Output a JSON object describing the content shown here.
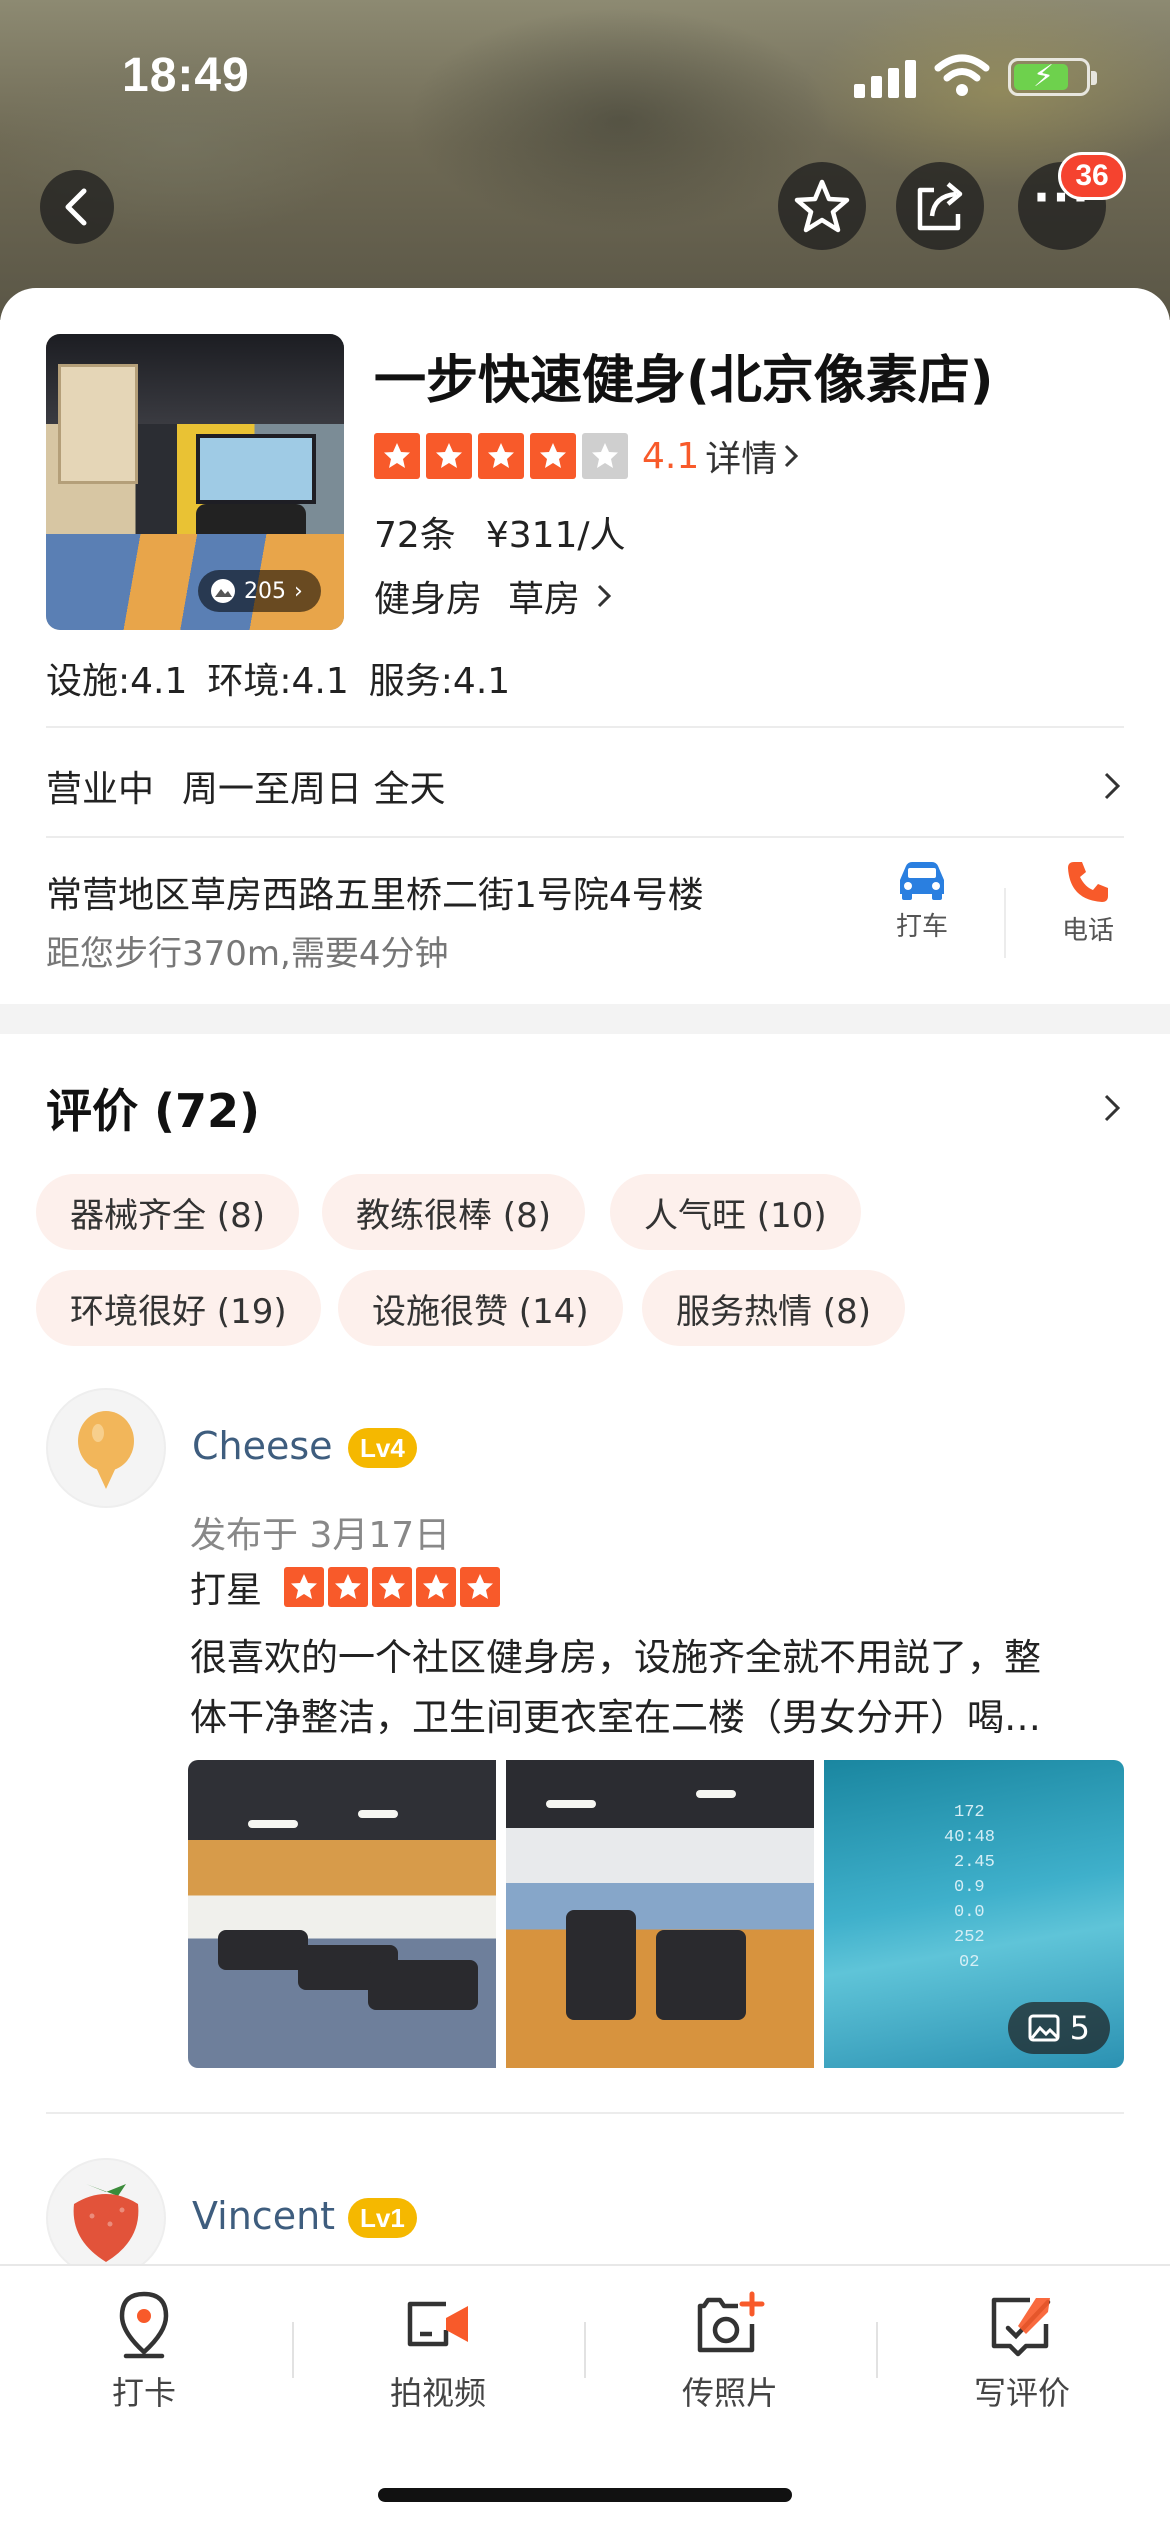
{
  "status_bar": {
    "time": "18:49"
  },
  "header": {
    "notification_count": "36"
  },
  "shop": {
    "name": "一步快速健身(北京像素店)",
    "photo_count": "205",
    "rating": "4.1",
    "rating_stars": 4,
    "detail_link": "详情",
    "review_count": "72条",
    "price": "¥311/人",
    "category": "健身房",
    "area": "草房",
    "scores": [
      "设施:4.1",
      "环境:4.1",
      "服务:4.1"
    ]
  },
  "hours": {
    "status": "营业中",
    "schedule": "周一至周日 全天"
  },
  "location": {
    "address": "常营地区草房西路五里桥二街1号院4号楼",
    "distance": "距您步行370m,需要4分钟",
    "taxi_label": "打车",
    "phone_label": "电话"
  },
  "reviews": {
    "title": "评价 (72)",
    "tags": [
      "器械齐全 (8)",
      "教练很棒 (8)",
      "人气旺 (10)",
      "环境很好 (19)",
      "设施很赞 (14)",
      "服务热情 (8)"
    ],
    "items": [
      {
        "user": "Cheese",
        "level": "Lv4",
        "date": "发布于 3月17日",
        "rating_label": "打星",
        "rating_stars": 5,
        "text_line1": "很喜欢的一个社区健身房，设施齐全就不用説了，整",
        "text_line2": "体干净整洁，卫生间更衣室在二楼（男女分开）喝…",
        "photo_more": "5",
        "screen_lines": [
          "172",
          "40:48",
          "2.45",
          "0.9",
          "0.0",
          "252",
          "02"
        ]
      },
      {
        "user": "Vincent",
        "level": "Lv1"
      }
    ]
  },
  "tabbar": {
    "items": [
      {
        "label": "打卡",
        "icon": "location-pin-icon"
      },
      {
        "label": "拍视频",
        "icon": "video-camera-icon"
      },
      {
        "label": "传照片",
        "icon": "add-photo-icon"
      },
      {
        "label": "写评价",
        "icon": "write-review-icon"
      }
    ]
  },
  "colors": {
    "accent": "#f85a2a",
    "username": "#3e5d7e",
    "level_badge": "#f5b800",
    "tag_bg": "#fdf0ec"
  }
}
